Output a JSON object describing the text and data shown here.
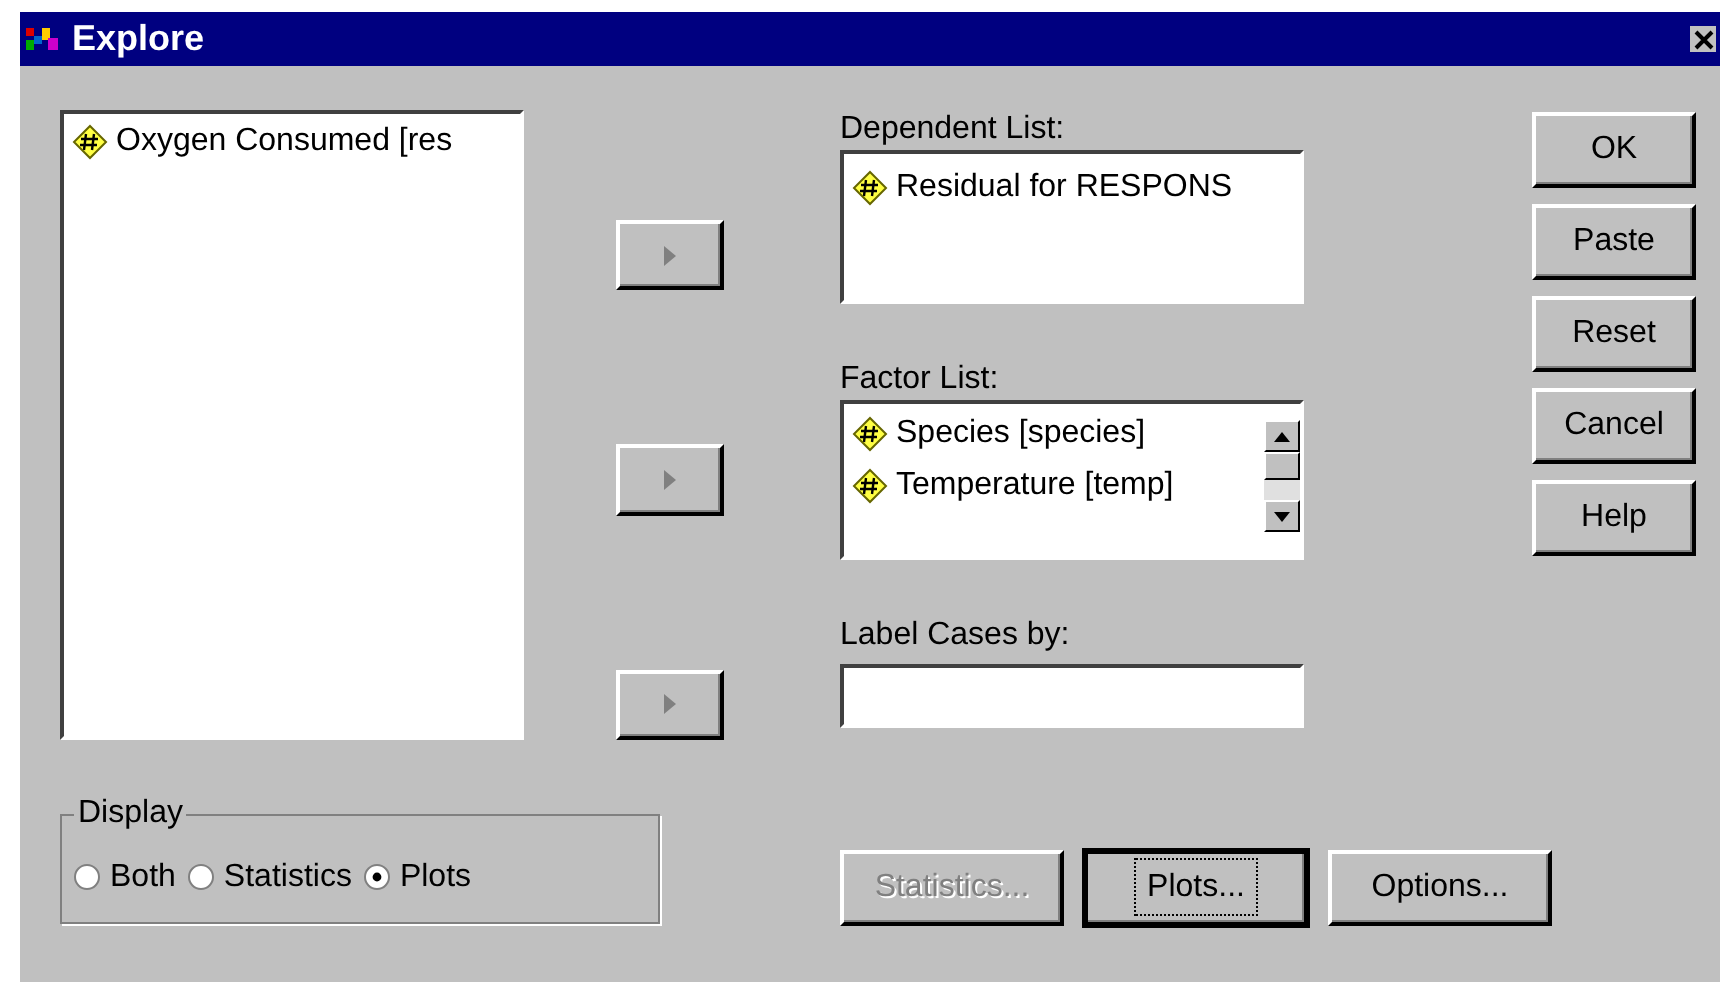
{
  "window": {
    "title": "Explore"
  },
  "source_list": {
    "items": [
      {
        "label": "Oxygen Consumed [res"
      }
    ]
  },
  "dependent_list": {
    "label": "Dependent List:",
    "items": [
      {
        "label": "Residual for RESPONS"
      }
    ]
  },
  "factor_list": {
    "label": "Factor List:",
    "items": [
      {
        "label": "Species [species]"
      },
      {
        "label": "Temperature [temp]"
      }
    ]
  },
  "label_cases": {
    "label": "Label Cases by:"
  },
  "display": {
    "title": "Display",
    "options": [
      {
        "label": "Both",
        "selected": false
      },
      {
        "label": "Statistics",
        "selected": false
      },
      {
        "label": "Plots",
        "selected": true
      }
    ]
  },
  "side_buttons": [
    {
      "label": "OK"
    },
    {
      "label": "Paste"
    },
    {
      "label": "Reset"
    },
    {
      "label": "Cancel"
    },
    {
      "label": "Help"
    }
  ],
  "bottom_buttons": [
    {
      "label": "Statistics...",
      "disabled": true,
      "focused": false
    },
    {
      "label": "Plots...",
      "disabled": false,
      "focused": true
    },
    {
      "label": "Options...",
      "disabled": false,
      "focused": false
    }
  ]
}
